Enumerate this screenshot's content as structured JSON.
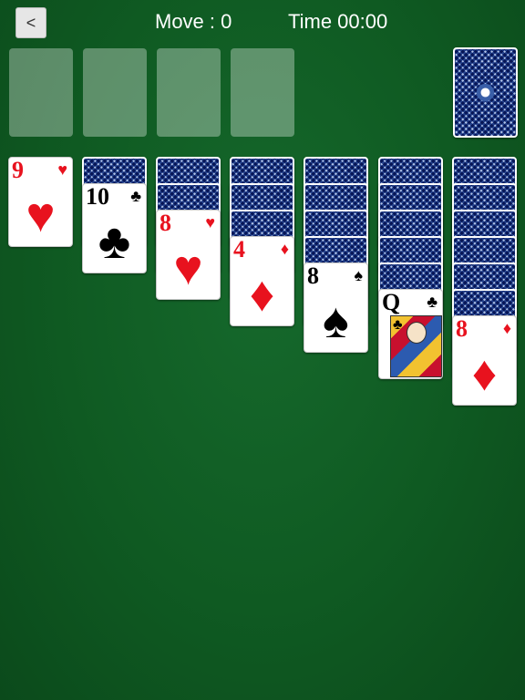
{
  "header": {
    "back_label": "<",
    "move_label": "Move : 0",
    "time_label": "Time 00:00"
  },
  "tableau": [
    {
      "face_down": 0,
      "face_up": [
        {
          "rank": "9",
          "suit": "♥",
          "color": "red"
        }
      ]
    },
    {
      "face_down": 1,
      "face_up": [
        {
          "rank": "10",
          "suit": "♣",
          "color": "black"
        }
      ]
    },
    {
      "face_down": 2,
      "face_up": [
        {
          "rank": "8",
          "suit": "♥",
          "color": "red"
        }
      ]
    },
    {
      "face_down": 3,
      "face_up": [
        {
          "rank": "4",
          "suit": "♦",
          "color": "red"
        }
      ]
    },
    {
      "face_down": 4,
      "face_up": [
        {
          "rank": "8",
          "suit": "♠",
          "color": "black"
        }
      ]
    },
    {
      "face_down": 5,
      "face_up": [
        {
          "rank": "Q",
          "suit": "♣",
          "color": "black",
          "court": true
        }
      ]
    },
    {
      "face_down": 6,
      "face_up": [
        {
          "rank": "8",
          "suit": "♦",
          "color": "red"
        }
      ]
    }
  ]
}
